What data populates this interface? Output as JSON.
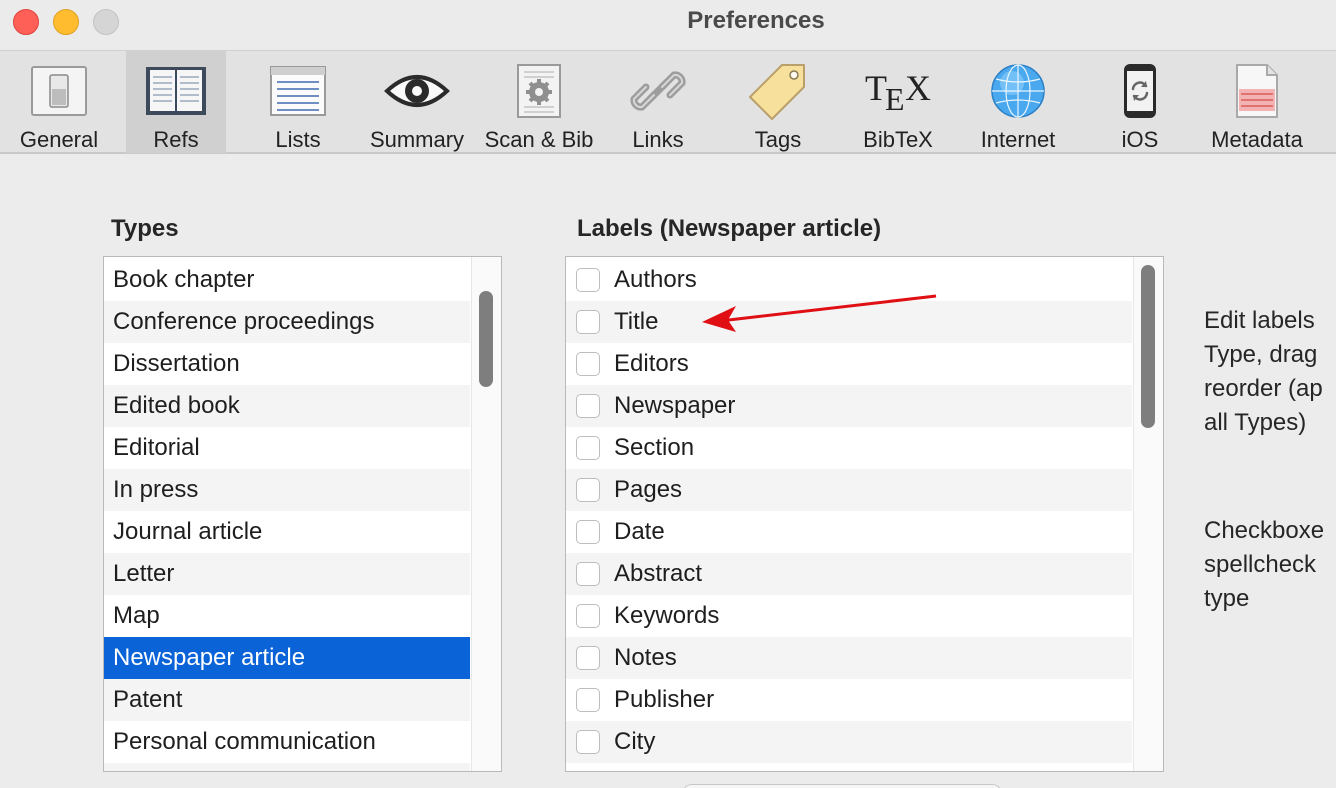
{
  "window": {
    "title": "Preferences"
  },
  "toolbar": {
    "items": [
      {
        "label": "General",
        "icon": "switch-icon"
      },
      {
        "label": "Refs",
        "icon": "open-book-icon",
        "selected": true
      },
      {
        "label": "Lists",
        "icon": "list-window-icon"
      },
      {
        "label": "Summary",
        "icon": "eye-icon"
      },
      {
        "label": "Scan & Bib",
        "icon": "document-gear-icon"
      },
      {
        "label": "Links",
        "icon": "chain-link-icon"
      },
      {
        "label": "Tags",
        "icon": "tag-icon"
      },
      {
        "label": "BibTeX",
        "icon": "tex-logo-icon"
      },
      {
        "label": "Internet",
        "icon": "globe-icon"
      },
      {
        "label": "iOS",
        "icon": "phone-sync-icon"
      },
      {
        "label": "Metadata",
        "icon": "metadata-document-icon"
      }
    ]
  },
  "types": {
    "title": "Types",
    "items": [
      "Book chapter",
      "Conference proceedings",
      "Dissertation",
      "Edited book",
      "Editorial",
      "In press",
      "Journal article",
      "Letter",
      "Map",
      "Newspaper article",
      "Patent",
      "Personal communication"
    ],
    "selected": "Newspaper article"
  },
  "labels": {
    "title": "Labels (Newspaper article)",
    "items": [
      "Authors",
      "Title",
      "Editors",
      "Newspaper",
      "Section",
      "Pages",
      "Date",
      "Abstract",
      "Keywords",
      "Notes",
      "Publisher",
      "City"
    ]
  },
  "help": {
    "labels_help": [
      "Edit labels",
      "Type, drag",
      "reorder (ap",
      "all Types)"
    ],
    "checkbox_help": [
      "Checkboxe",
      "spellcheck",
      "type"
    ]
  },
  "colors": {
    "selection": "#0b63d8",
    "annotation_arrow": "#e00f14"
  }
}
